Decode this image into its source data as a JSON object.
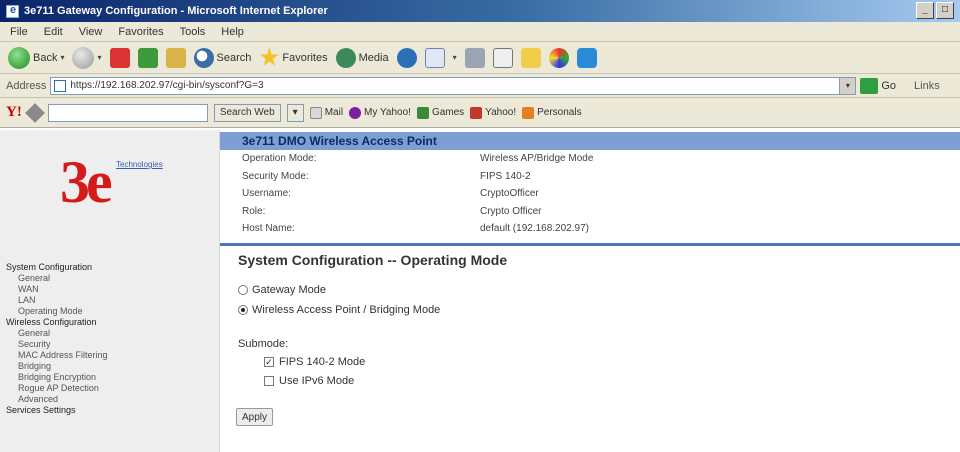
{
  "window": {
    "title": "3e711 Gateway Configuration - Microsoft Internet Explorer",
    "min": "_",
    "max": "□"
  },
  "menu": [
    "File",
    "Edit",
    "View",
    "Favorites",
    "Tools",
    "Help"
  ],
  "toolbar": {
    "back": "Back",
    "search": "Search",
    "favorites": "Favorites",
    "media": "Media",
    "dropdown": "▾"
  },
  "address": {
    "label": "Address",
    "url": "https://192.168.202.97/cgi-bin/sysconf?G=3",
    "go": "Go",
    "links": "Links"
  },
  "yahoo": {
    "logo": "Y!",
    "search_button": "Search Web",
    "mail": "Mail",
    "my_yahoo": "My Yahoo!",
    "games": "Games",
    "yahoo": "Yahoo!",
    "personals": "Personals"
  },
  "logo": {
    "mark": "3e",
    "tagline": "Technologies"
  },
  "nav": {
    "system_config": "System Configuration",
    "general": "General",
    "wan": "WAN",
    "lan": "LAN",
    "operating_mode": "Operating Mode",
    "wireless_config": "Wireless Configuration",
    "w_general": "General",
    "security": "Security",
    "mac_filtering": "MAC Address Filtering",
    "bridging": "Bridging",
    "bridging_encryption": "Bridging Encryption",
    "rogue_ap": "Rogue AP Detection",
    "advanced": "Advanced",
    "services": "Services Settings"
  },
  "info": {
    "title": "3e711 DMO Wireless Access Point",
    "rows": [
      {
        "key": "Operation Mode:",
        "value": "Wireless AP/Bridge Mode"
      },
      {
        "key": "Security Mode:",
        "value": "FIPS 140-2"
      },
      {
        "key": "Username:",
        "value": "CryptoOfficer"
      },
      {
        "key": "Role:",
        "value": "Crypto Officer"
      },
      {
        "key": "Host Name:",
        "value": "default (192.168.202.97)"
      }
    ]
  },
  "page": {
    "heading": "System Configuration -- Operating Mode",
    "gateway_mode": "Gateway Mode",
    "ap_bridging_mode": "Wireless Access Point / Bridging Mode",
    "submode_label": "Submode:",
    "fips_mode": "FIPS 140-2 Mode",
    "ipv6_mode": "Use IPv6 Mode",
    "apply": "Apply",
    "check_mark": "✓"
  }
}
